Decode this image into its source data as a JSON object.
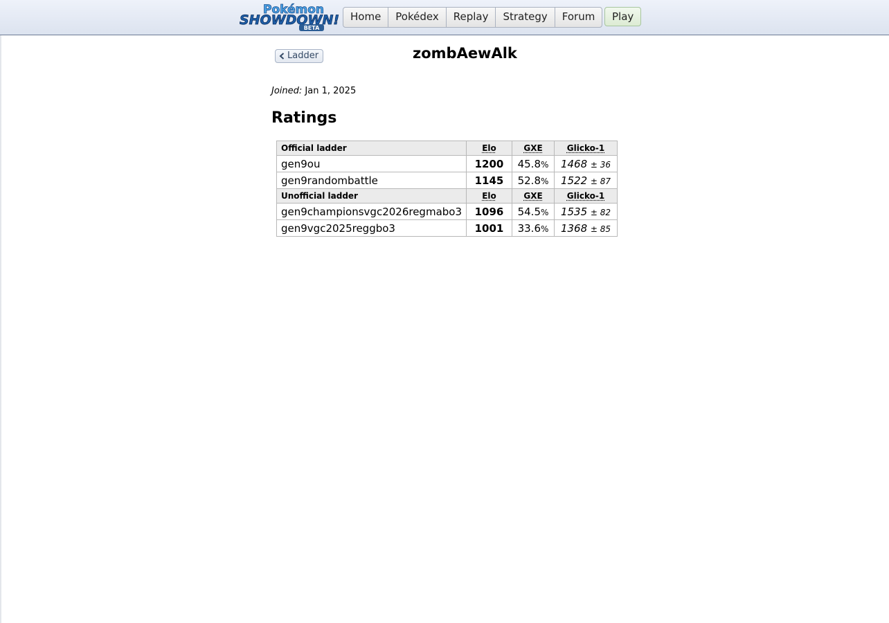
{
  "header": {
    "logo": {
      "line1": "Pokémon",
      "line2": "SHOWDOWN!",
      "badge": "BETA"
    },
    "nav": [
      "Home",
      "Pokédex",
      "Replay",
      "Strategy",
      "Forum"
    ],
    "play_label": "Play"
  },
  "back_label": "Ladder",
  "username": "zombAewAlk",
  "joined": {
    "label": "Joined:",
    "date": "Jan 1, 2025"
  },
  "ratings_heading": "Ratings",
  "official": {
    "title": "Official ladder",
    "cols": {
      "elo": "Elo",
      "gxe": "GXE",
      "glicko": "Glicko-1"
    },
    "rows": [
      {
        "format": "gen9ou",
        "elo": "1200",
        "gxe": "45.8",
        "gxe_unit": "%",
        "glicko": "1468",
        "dev": "± 36"
      },
      {
        "format": "gen9randombattle",
        "elo": "1145",
        "gxe": "52.8",
        "gxe_unit": "%",
        "glicko": "1522",
        "dev": "± 87"
      }
    ]
  },
  "unofficial": {
    "title": "Unofficial ladder",
    "cols": {
      "elo": "Elo",
      "gxe": "GXE",
      "glicko": "Glicko-1"
    },
    "rows": [
      {
        "format": "gen9championsvgc2026regmabo3",
        "elo": "1096",
        "gxe": "54.5",
        "gxe_unit": "%",
        "glicko": "1535",
        "dev": "± 82"
      },
      {
        "format": "gen9vgc2025reggbo3",
        "elo": "1001",
        "gxe": "33.6",
        "gxe_unit": "%",
        "glicko": "1368",
        "dev": "± 85"
      }
    ]
  },
  "colors": {
    "brand_blue": "#1d5ea8",
    "logo_light": "#4aa3e6",
    "header_border": "#6b7a93"
  },
  "icons": {
    "back": "chevron-left-icon"
  }
}
